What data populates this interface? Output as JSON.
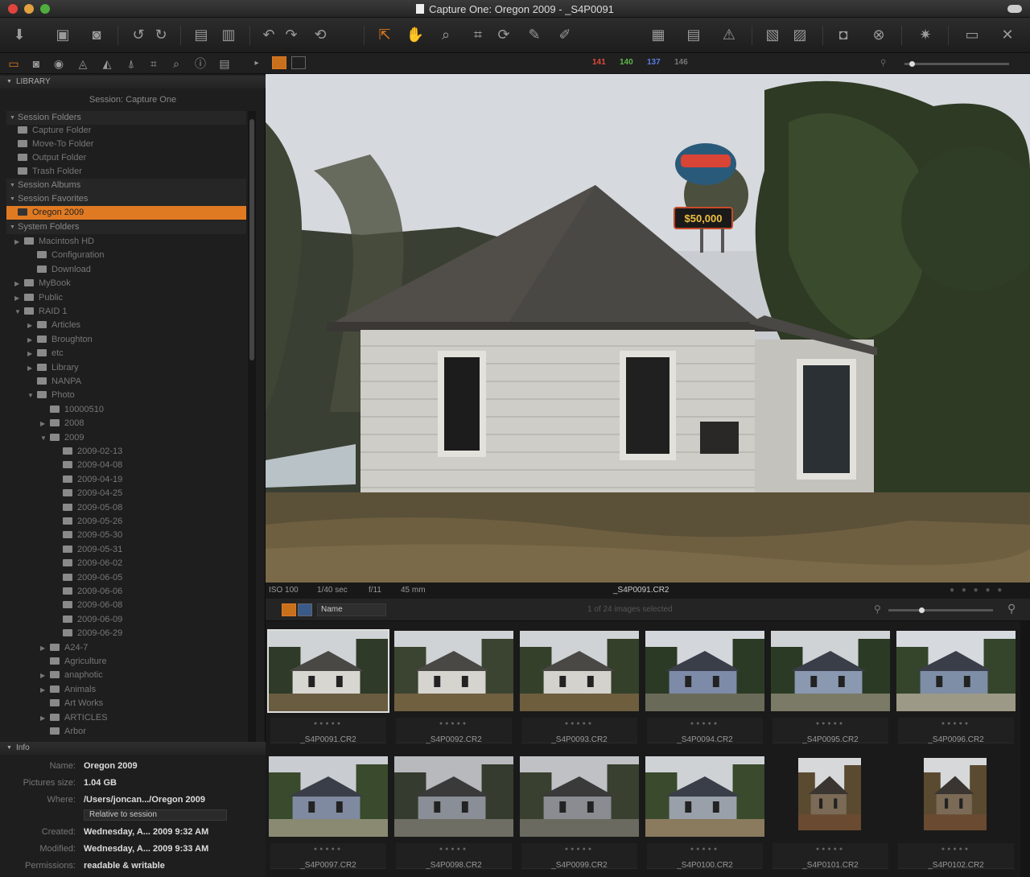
{
  "window": {
    "title": "Capture One: Oregon 2009 - _S4P0091"
  },
  "toolbar": {
    "icons": [
      "import-icon",
      "camera-icon",
      "capture-icon",
      "rotate-left-icon",
      "rotate-right-icon",
      "move-icon",
      "trash-icon",
      "undo-icon",
      "redo-icon",
      "reset-icon",
      "pick-tool-icon",
      "pan-icon",
      "zoom-icon",
      "crop-icon",
      "rotate-icon",
      "keystone-icon",
      "spot-icon",
      "grid-icon",
      "proof-icon",
      "print-icon",
      "warning-icon",
      "export-icon",
      "output-icon",
      "camera-body-icon",
      "settings-icon",
      "gear-icon",
      "fullscreen-icon",
      "tools-icon"
    ]
  },
  "viewer_bar": {
    "counts": [
      {
        "label": "141",
        "color": "#e04a3a"
      },
      {
        "label": "140",
        "color": "#5fb84a"
      },
      {
        "label": "137",
        "color": "#5a7ee0"
      },
      {
        "label": "146",
        "color": "#777777"
      }
    ]
  },
  "library": {
    "header": "LIBRARY",
    "session_title": "Session: Capture One",
    "groups": {
      "session_folders": "Session Folders",
      "session_albums": "Session Albums",
      "session_favorites": "Session Favorites",
      "system_folders": "System Folders"
    },
    "session_folder_items": [
      "Capture Folder",
      "Move-To Folder",
      "Output Folder",
      "Trash Folder"
    ],
    "favorite_selected": "Oregon 2009",
    "system_items": [
      "Macintosh HD",
      "Configuration",
      "Download",
      "MyBook",
      "Public",
      "RAID 1",
      "Articles",
      "Broughton",
      "etc",
      "Library",
      "NANPA",
      "Photo",
      "10000510",
      "2008",
      "2009",
      "2009-02-13",
      "2009-04-08",
      "2009-04-19",
      "2009-04-25",
      "2009-05-08",
      "2009-05-26",
      "2009-05-30",
      "2009-05-31",
      "2009-06-02",
      "2009-06-05",
      "2009-06-06",
      "2009-06-08",
      "2009-06-09",
      "2009-06-29",
      "A24-7",
      "Agriculture",
      "anaphotic",
      "Animals",
      "Art Works",
      "ARTICLES",
      "Arbor"
    ]
  },
  "info": {
    "header": "Info",
    "name_label": "Name:",
    "name": "Oregon 2009",
    "size_label": "Pictures size:",
    "size": "1.04 GB",
    "where_label": "Where:",
    "where": "/Users/joncan.../Oregon 2009",
    "relative": "Relative to session",
    "created_label": "Created:",
    "created": "Wednesday, A... 2009 9:32 AM",
    "modified_label": "Modified:",
    "modified": "Wednesday, A... 2009 9:33 AM",
    "permissions_label": "Permissions:",
    "permissions": "readable & writable"
  },
  "viewer": {
    "image_alt": "abandoned white wooden house with sign",
    "sign_text": "$50,000",
    "iso": "ISO 100",
    "shutter": "1/40 sec",
    "aperture": "f/11",
    "focal": "45 mm",
    "filename": "_S4P0091.CR2"
  },
  "browser": {
    "sort_label": "Name",
    "selection_status": "1 of 24 images selected",
    "thumbnails": [
      {
        "name": "_S4P0091.CR2",
        "selected": true
      },
      {
        "name": "_S4P0092.CR2",
        "selected": false
      },
      {
        "name": "_S4P0093.CR2",
        "selected": false
      },
      {
        "name": "_S4P0094.CR2",
        "selected": false
      },
      {
        "name": "_S4P0095.CR2",
        "selected": false
      },
      {
        "name": "_S4P0096.CR2",
        "selected": false
      },
      {
        "name": "_S4P0097.CR2",
        "selected": false
      },
      {
        "name": "_S4P0098.CR2",
        "selected": false
      },
      {
        "name": "_S4P0099.CR2",
        "selected": false
      },
      {
        "name": "_S4P0100.CR2",
        "selected": false
      },
      {
        "name": "_S4P0101.CR2",
        "selected": false
      },
      {
        "name": "_S4P0102.CR2",
        "selected": false
      }
    ]
  }
}
